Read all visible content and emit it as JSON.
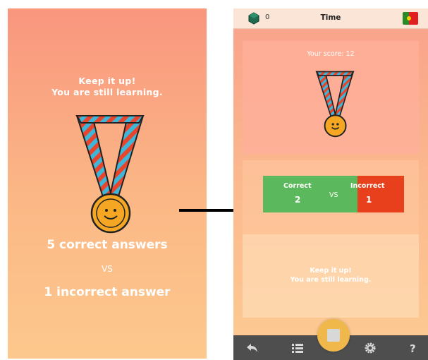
{
  "left_panel": {
    "message_line1": "Keep it up!",
    "message_line2": "You are still learning.",
    "correct_text": "5 correct answers",
    "vs_text": "VS",
    "incorrect_text": "1 incorrect answer"
  },
  "right_panel": {
    "top_bar": {
      "gem_count": "0",
      "title": "Time",
      "gem_icon": "gem-icon",
      "flag_icon": "portugal-flag-icon"
    },
    "score_text": "Your score: 12",
    "comparison": {
      "correct_label": "Correct",
      "correct_value": "2",
      "vs_label": "VS",
      "incorrect_label": "Incorrect",
      "incorrect_value": "1"
    },
    "message_line1": "Keep it up!",
    "message_line2": "You are still learning.",
    "bottom_nav": [
      "back-arrow-icon",
      "list-icon",
      "stop-button",
      "gear-icon",
      "help-icon"
    ]
  },
  "colors": {
    "correct": "#5cb85c",
    "incorrect": "#e8401c",
    "medal": "#f5a623",
    "ribbon_red": "#e8452c",
    "ribbon_blue": "#3fb6d8"
  }
}
